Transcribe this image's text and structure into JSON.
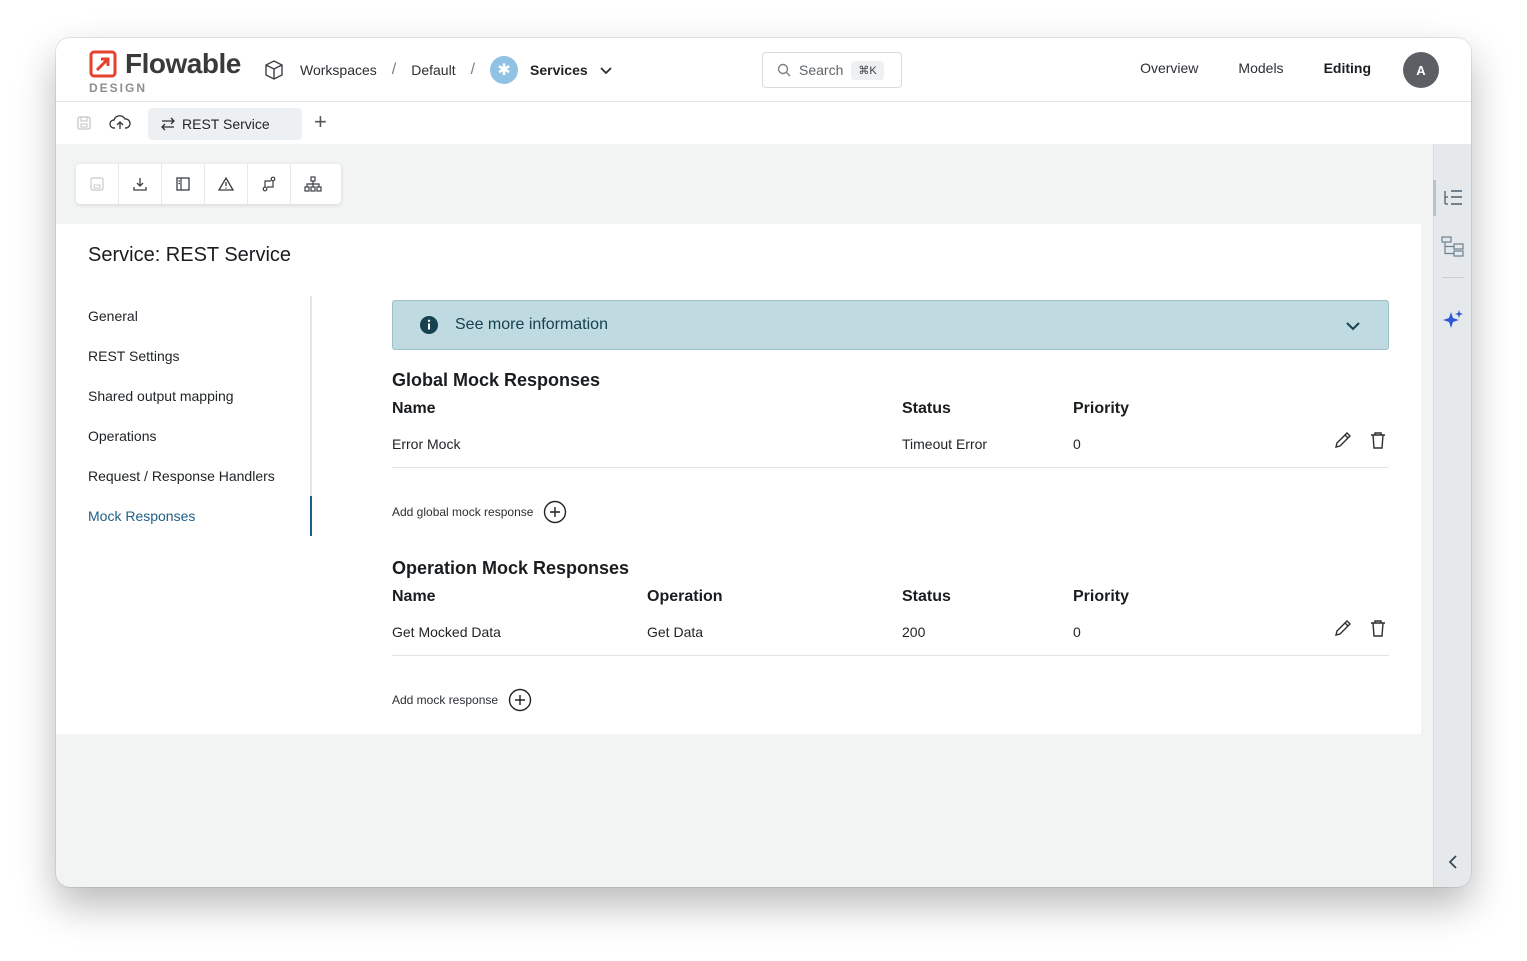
{
  "brand": {
    "name": "Flowable",
    "sub": "DESIGN",
    "accent": "#e4402f"
  },
  "breadcrumb": {
    "workspaces": "Workspaces",
    "default": "Default",
    "services": "Services",
    "sep": "/"
  },
  "search": {
    "placeholder": "Search",
    "shortcut": "⌘K"
  },
  "topnav": {
    "overview": "Overview",
    "models": "Models",
    "editing": "Editing"
  },
  "user": {
    "initial": "A"
  },
  "tabs": [
    {
      "label": "REST Service"
    }
  ],
  "panel": {
    "title": "Service: REST Service",
    "nav": [
      "General",
      "REST Settings",
      "Shared output mapping",
      "Operations",
      "Request / Response Handlers",
      "Mock Responses"
    ],
    "info": "See more information",
    "global": {
      "title": "Global Mock Responses",
      "headers": {
        "name": "Name",
        "status": "Status",
        "priority": "Priority"
      },
      "rows": [
        {
          "name": "Error Mock",
          "status": "Timeout Error",
          "priority": "0"
        }
      ],
      "add": "Add global mock response"
    },
    "operation": {
      "title": "Operation Mock Responses",
      "headers": {
        "name": "Name",
        "operation": "Operation",
        "status": "Status",
        "priority": "Priority"
      },
      "rows": [
        {
          "name": "Get Mocked Data",
          "operation": "Get Data",
          "status": "200",
          "priority": "0"
        }
      ],
      "add": "Add mock response"
    }
  }
}
